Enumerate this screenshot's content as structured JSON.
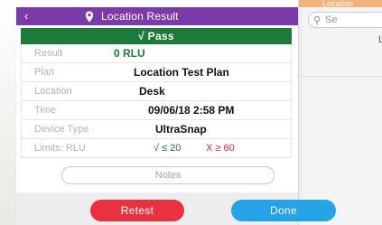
{
  "side_screen": {
    "header_text": "Location",
    "search_placeholder": "Se",
    "row_text": "L"
  },
  "header": {
    "back_icon": "‹",
    "title": "Location Result",
    "icon": "location-pin-icon"
  },
  "status": {
    "text": "√ Pass",
    "color": "#1c7a3a"
  },
  "details": {
    "result": {
      "label": "Result",
      "value": "0 RLU"
    },
    "plan": {
      "label": "Plan",
      "value": "Location Test Plan"
    },
    "location": {
      "label": "Location",
      "value": "Desk"
    },
    "time": {
      "label": "Time",
      "value": "09/06/18 2:58 PM"
    },
    "device_type": {
      "label": "Device Type",
      "value": "UltraSnap"
    },
    "limits": {
      "label": "Limits: RLU",
      "pass_text": "√ ≤ 20",
      "fail_text": "X ≥ 60",
      "pass_color": "#1c7a3a",
      "fail_color": "#d9262f"
    }
  },
  "notes": {
    "label": "Notes"
  },
  "actions": {
    "retest_label": "Retest",
    "done_label": "Done",
    "retest_color": "#e8323f",
    "done_color": "#25a3e6"
  },
  "colors": {
    "header_bg": "#7a3aa8",
    "accent_orange": "#f2b37a"
  }
}
